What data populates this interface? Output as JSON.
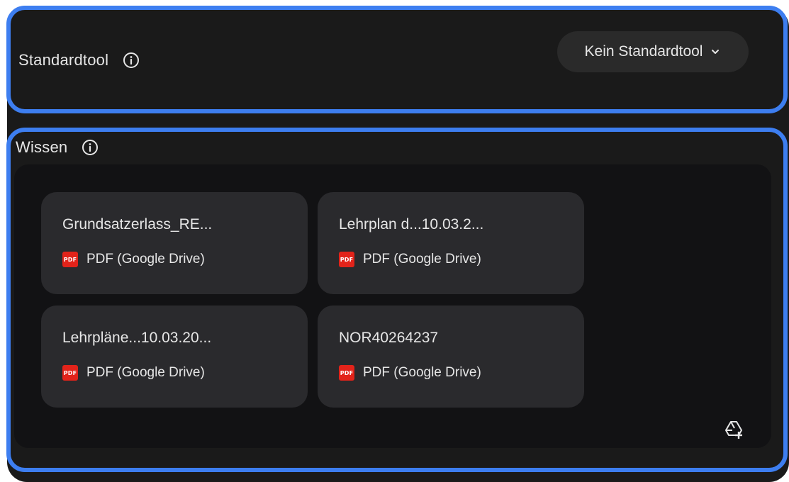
{
  "standard_tool": {
    "label": "Standardtool",
    "dropdown_value": "Kein Standardtool"
  },
  "knowledge": {
    "label": "Wissen",
    "files": [
      {
        "name": "Grundsatzerlass_RE...",
        "type": "PDF (Google Drive)"
      },
      {
        "name": "Lehrplan d...10.03.2...",
        "type": "PDF (Google Drive)"
      },
      {
        "name": "Lehrpläne...10.03.20...",
        "type": "PDF (Google Drive)"
      },
      {
        "name": "NOR40264237",
        "type": "PDF (Google Drive)"
      }
    ],
    "pdf_badge": "PDF"
  },
  "icons": {
    "info": "info-circle-icon",
    "chevron": "chevron-down-icon",
    "add": "google-drive-add-icon"
  },
  "colors": {
    "highlight": "#3d7ef0",
    "panel": "#1a1a1a",
    "card": "#2a2a2d",
    "pdf_red": "#e2231a"
  }
}
